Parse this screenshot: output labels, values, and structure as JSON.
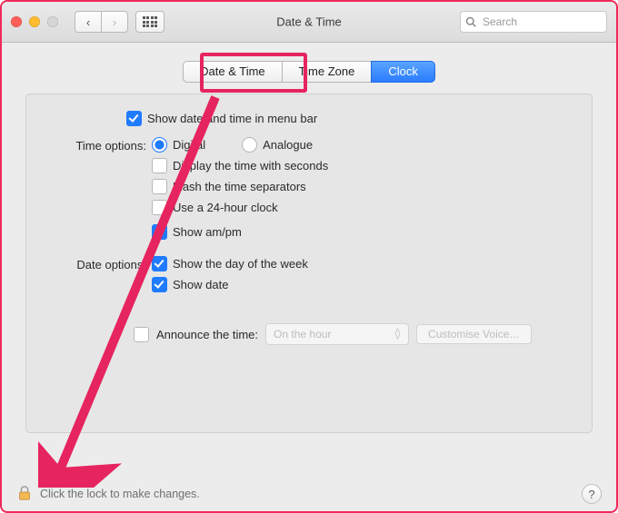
{
  "toolbar": {
    "title": "Date & Time",
    "search_placeholder": "Search"
  },
  "tabs": [
    {
      "label": "Date & Time",
      "selected": false
    },
    {
      "label": "Time Zone",
      "selected": false
    },
    {
      "label": "Clock",
      "selected": true
    }
  ],
  "options": {
    "show_in_menu_bar": {
      "label": "Show date and time in menu bar",
      "checked": true
    },
    "time_options_label": "Time options:",
    "time_format": {
      "digital": {
        "label": "Digital",
        "checked": true
      },
      "analogue": {
        "label": "Analogue",
        "checked": false
      }
    },
    "display_seconds": {
      "label": "Display the time with seconds",
      "checked": false
    },
    "flash_separators": {
      "label": "Flash the time separators",
      "checked": false
    },
    "use_24h": {
      "label": "Use a 24-hour clock",
      "checked": false
    },
    "show_ampm": {
      "label": "Show am/pm",
      "checked": true
    },
    "date_options_label": "Date options:",
    "show_day_of_week": {
      "label": "Show the day of the week",
      "checked": true
    },
    "show_date": {
      "label": "Show date",
      "checked": true
    },
    "announce": {
      "label": "Announce the time:",
      "checked": false,
      "interval": "On the hour",
      "customise_label": "Customise Voice…"
    }
  },
  "footer": {
    "lock_text": "Click the lock to make changes.",
    "help_label": "?"
  },
  "colors": {
    "accent_blue": "#1f7bff",
    "highlight_pink": "#e6245f"
  }
}
